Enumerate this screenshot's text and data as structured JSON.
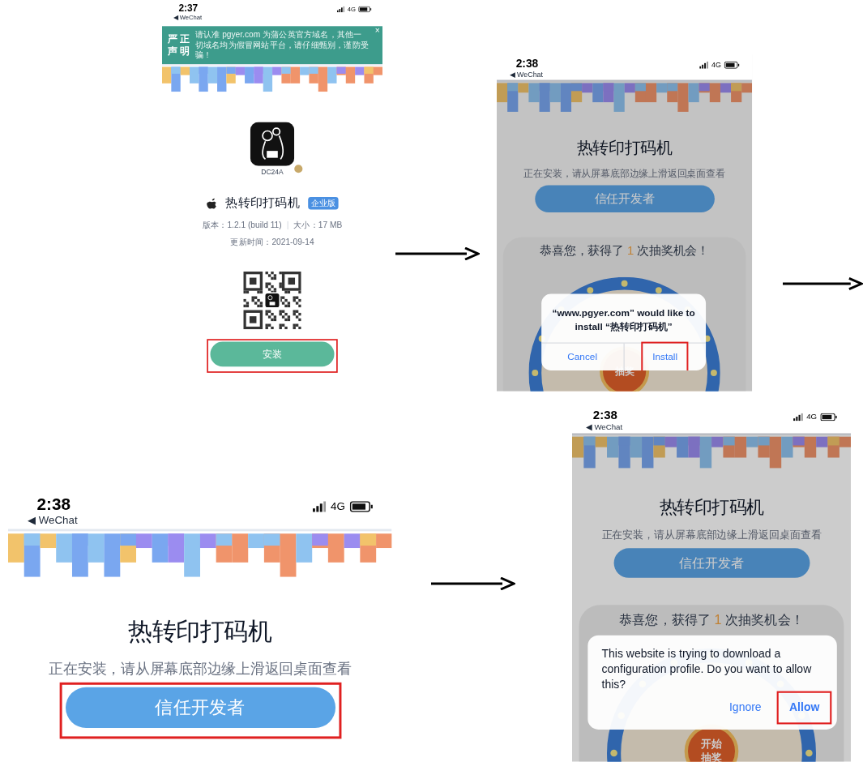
{
  "screens": [
    {
      "kind": "download",
      "status_bar": {
        "time": "2:37",
        "back": "◀ WeChat",
        "network": "4G"
      },
      "notice": {
        "label": [
          "严 正",
          "声 明"
        ],
        "text": "请认准 pgyer.com 为蒲公英官方域名，其他一切域名均为假冒网站平台，请仔细甄别，谨防受骗！",
        "close": "×"
      },
      "app": {
        "icon_caption": "DC24A",
        "name": "热转印打码机",
        "badge": "企业版",
        "version": "版本：1.2.1 (build 11)",
        "size": "大小：17 MB",
        "updated": "更新时间：2021-09-14"
      },
      "install_button": {
        "label": "安装",
        "highlighted": true
      }
    },
    {
      "kind": "installing",
      "status_bar": {
        "time": "2:38",
        "back": "◀ WeChat",
        "network": "4G"
      },
      "title": "热转印打码机",
      "subtitle": "正在安装，请从屏幕底部边缘上滑返回桌面查看",
      "trust_button": {
        "label": "信任开发者",
        "highlighted": false
      },
      "prize": {
        "text": "恭喜您，获得了 **1** 次抽奖机会！",
        "wheel_label": "抽奖"
      },
      "dialog": {
        "kind": "split",
        "message": "“www.pgyer.com” would like to install “热转印打码机”",
        "buttons": [
          {
            "label": "Cancel",
            "highlighted": false
          },
          {
            "label": "Install",
            "highlighted": true
          }
        ]
      }
    },
    {
      "kind": "installing",
      "status_bar": {
        "time": "2:38",
        "back": "◀ WeChat",
        "network": "4G"
      },
      "title": "热转印打码机",
      "subtitle": "正在安装，请从屏幕底部边缘上滑返回桌面查看",
      "trust_button": {
        "label": "信任开发者",
        "highlighted": true
      }
    },
    {
      "kind": "installing",
      "status_bar": {
        "time": "2:38",
        "back": "◀ WeChat",
        "network": "4G"
      },
      "title": "热转印打码机",
      "subtitle": "正在安装，请从屏幕底部边缘上滑返回桌面查看",
      "trust_button": {
        "label": "信任开发者",
        "highlighted": false
      },
      "prize": {
        "text": "恭喜您，获得了 **1** 次抽奖机会！",
        "wheel_label": "开始抽奖"
      },
      "dialog": {
        "kind": "inline",
        "message": "This website is trying to download a configuration profile. Do you want to allow this?",
        "buttons": [
          {
            "label": "Ignore",
            "highlighted": false
          },
          {
            "label": "Allow",
            "highlighted": true
          }
        ]
      }
    }
  ]
}
